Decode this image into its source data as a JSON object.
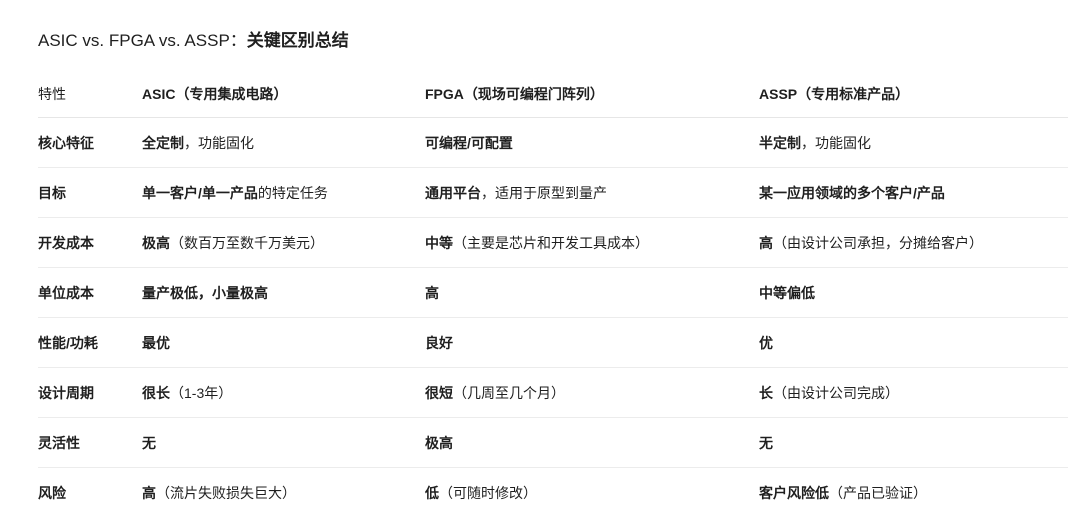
{
  "title": {
    "prefix": "ASIC vs. FPGA vs. ASSP：",
    "emphasis": "关键区别总结"
  },
  "table": {
    "headers": {
      "attribute": "特性",
      "asic": "ASIC（专用集成电路）",
      "fpga": "FPGA（现场可编程门阵列）",
      "assp": "ASSP（专用标准产品）"
    },
    "rows": [
      {
        "attribute": "核心特征",
        "asic": {
          "bold": "全定制",
          "rest": "，功能固化"
        },
        "fpga": {
          "bold": "可编程/可配置",
          "rest": ""
        },
        "assp": {
          "bold": "半定制",
          "rest": "，功能固化"
        }
      },
      {
        "attribute": "目标",
        "asic": {
          "bold": "单一客户/单一产品",
          "rest": "的特定任务"
        },
        "fpga": {
          "bold": "通用平台",
          "rest": "，适用于原型到量产"
        },
        "assp": {
          "bold": "某一应用领域的多个客户/产品",
          "rest": ""
        }
      },
      {
        "attribute": "开发成本",
        "asic": {
          "bold": "极高",
          "rest": "（数百万至数千万美元）"
        },
        "fpga": {
          "bold": "中等",
          "rest": "（主要是芯片和开发工具成本）"
        },
        "assp": {
          "bold": "高",
          "rest": "（由设计公司承担，分摊给客户）"
        }
      },
      {
        "attribute": "单位成本",
        "asic": {
          "bold": "量产极低，小量极高",
          "rest": ""
        },
        "fpga": {
          "bold": "高",
          "rest": ""
        },
        "assp": {
          "bold": "中等偏低",
          "rest": ""
        }
      },
      {
        "attribute": "性能/功耗",
        "asic": {
          "bold": "最优",
          "rest": ""
        },
        "fpga": {
          "bold": "良好",
          "rest": ""
        },
        "assp": {
          "bold": "优",
          "rest": ""
        }
      },
      {
        "attribute": "设计周期",
        "asic": {
          "bold": "很长",
          "rest": "（1-3年）"
        },
        "fpga": {
          "bold": "很短",
          "rest": "（几周至几个月）"
        },
        "assp": {
          "bold": "长",
          "rest": "（由设计公司完成）"
        }
      },
      {
        "attribute": "灵活性",
        "asic": {
          "bold": "无",
          "rest": ""
        },
        "fpga": {
          "bold": "极高",
          "rest": ""
        },
        "assp": {
          "bold": "无",
          "rest": ""
        }
      },
      {
        "attribute": "风险",
        "asic": {
          "bold": "高",
          "rest": "（流片失败损失巨大）"
        },
        "fpga": {
          "bold": "低",
          "rest": "（可随时修改）"
        },
        "assp": {
          "bold": "客户风险低",
          "rest": "（产品已验证）"
        }
      }
    ]
  }
}
